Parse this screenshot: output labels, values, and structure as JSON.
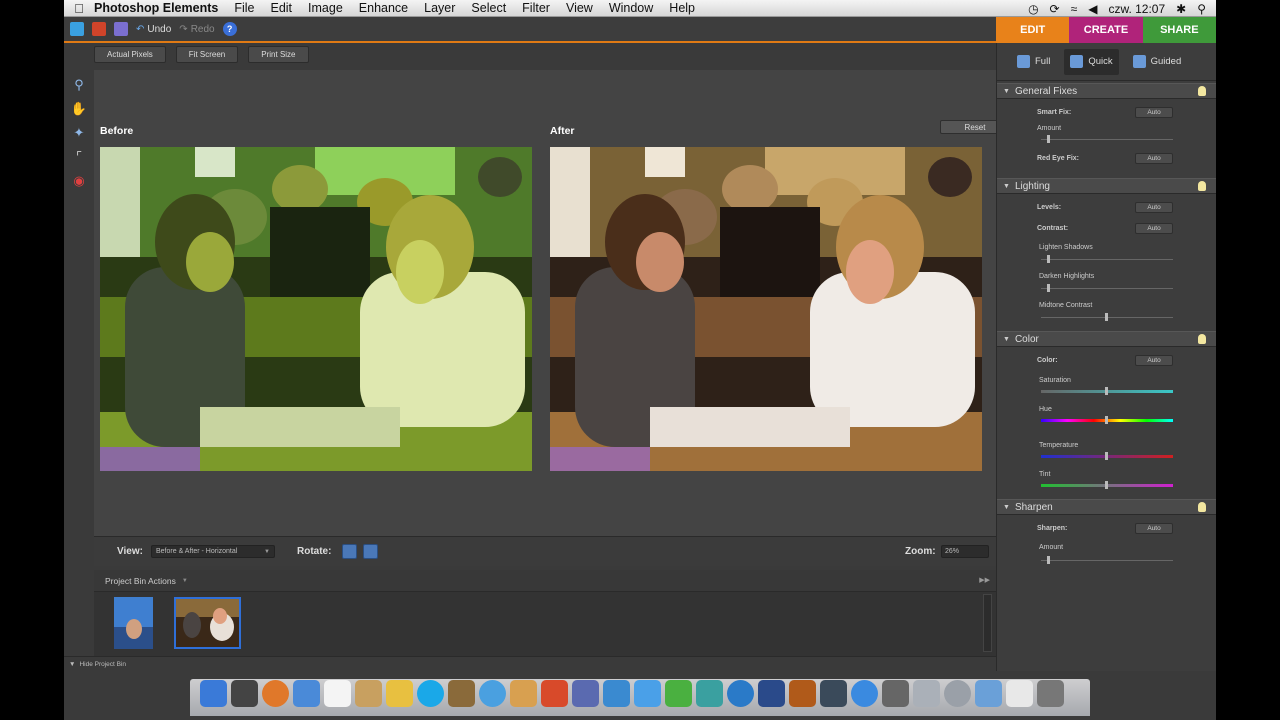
{
  "menubar": {
    "app": "Photoshop Elements",
    "items": [
      "File",
      "Edit",
      "Image",
      "Enhance",
      "Layer",
      "Select",
      "Filter",
      "View",
      "Window",
      "Help"
    ],
    "clock": "czw. 12:07"
  },
  "toolbar": {
    "undo": "Undo",
    "redo": "Redo",
    "help": "?"
  },
  "modes": {
    "edit": "EDIT",
    "create": "CREATE",
    "share": "SHARE"
  },
  "view_buttons": [
    "Actual Pixels",
    "Fit Screen",
    "Print Size"
  ],
  "canvas": {
    "before": "Before",
    "after": "After",
    "reset": "Reset"
  },
  "viewbar": {
    "view_label": "View:",
    "view_value": "Before & After - Horizontal",
    "rotate_label": "Rotate:",
    "zoom_label": "Zoom:",
    "zoom_value": "26%"
  },
  "bin": {
    "header": "Project Bin Actions",
    "hide": "Hide Project Bin"
  },
  "panel": {
    "tabs": [
      "Full",
      "Quick",
      "Guided"
    ],
    "general": {
      "title": "General Fixes",
      "smart_fix": "Smart Fix:",
      "amount": "Amount",
      "red_eye": "Red Eye Fix:"
    },
    "lighting": {
      "title": "Lighting",
      "levels": "Levels:",
      "contrast": "Contrast:",
      "lighten": "Lighten Shadows",
      "darken": "Darken Highlights",
      "midtone": "Midtone Contrast"
    },
    "color": {
      "title": "Color",
      "color": "Color:",
      "saturation": "Saturation",
      "hue": "Hue",
      "temperature": "Temperature",
      "tint": "Tint"
    },
    "sharpen": {
      "title": "Sharpen",
      "sharpen": "Sharpen:",
      "amount": "Amount"
    },
    "auto": "Auto"
  }
}
